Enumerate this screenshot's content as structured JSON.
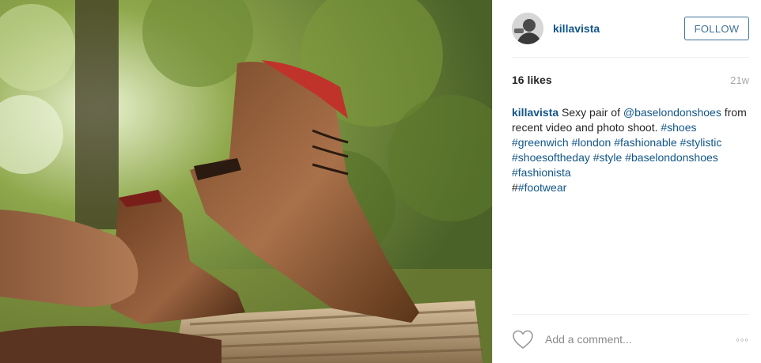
{
  "post": {
    "photo_alt": "",
    "header": {
      "username": "killavista",
      "follow_label": "FOLLOW"
    },
    "stats": {
      "likes": "16 likes",
      "age": "21w"
    },
    "caption": {
      "author": "killavista",
      "text_before_mention": " Sexy pair of ",
      "mention": "@baselondonshoes",
      "text_after_mention": " from recent video and photo shoot. ",
      "hashtags": [
        "#shoes",
        "#greenwich",
        "#london",
        "#fashionable",
        "#stylistic",
        "#shoesoftheday",
        "#style",
        "#baselondonshoes",
        "#fashionista"
      ],
      "last_prefix": "#",
      "last_hashtag": "#footwear"
    },
    "comment": {
      "placeholder": "Add a comment...",
      "more_label": "◦◦◦"
    },
    "icons": {
      "like": "heart-outline-icon",
      "more": "ellipsis-icon"
    },
    "colors": {
      "link": "#125688",
      "follow": "#3f729b"
    }
  }
}
